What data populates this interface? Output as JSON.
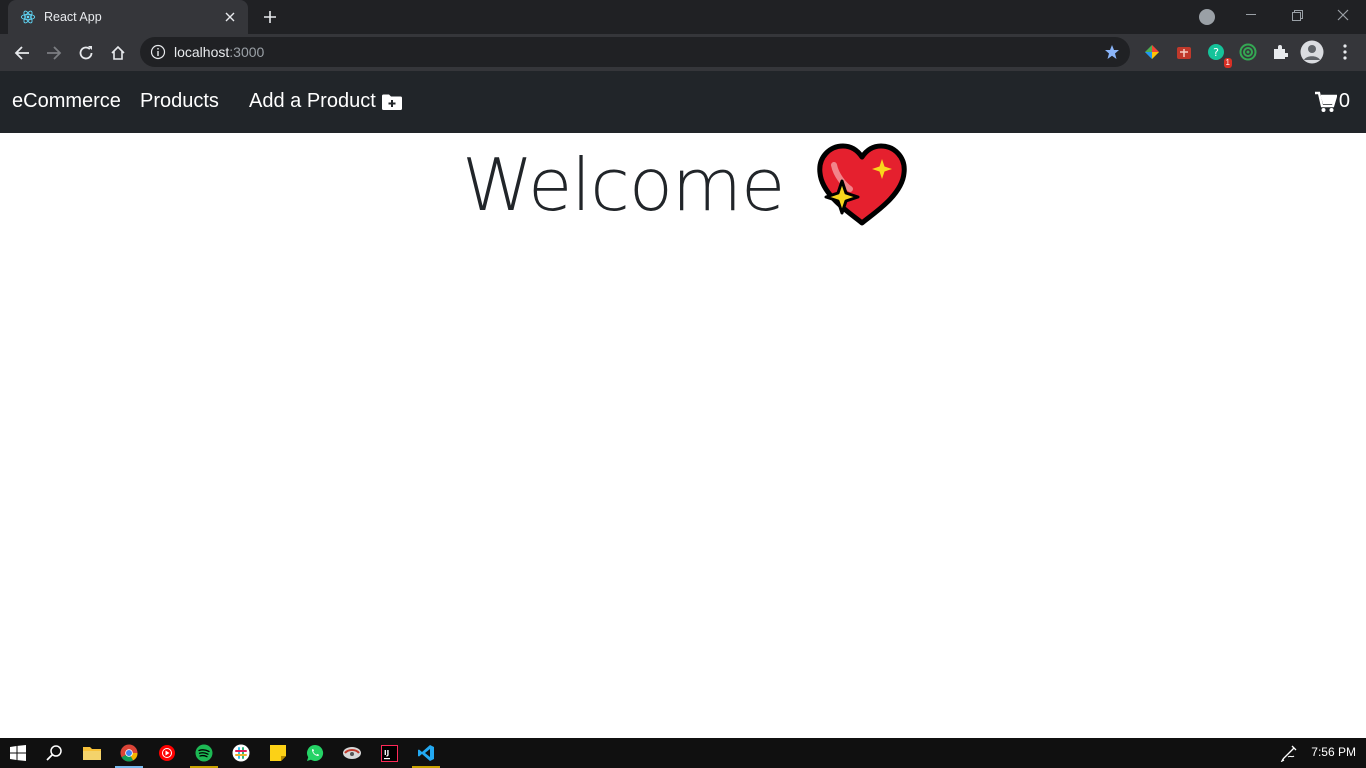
{
  "browser": {
    "tab_title": "React App",
    "url_host": "localhost",
    "url_port": ":3000",
    "extension_badge": "1"
  },
  "navbar": {
    "brand": "eCommerce",
    "links": [
      "Products",
      "Add a Product"
    ],
    "cart_count": "0"
  },
  "main": {
    "heading": "Welcome"
  },
  "taskbar": {
    "apps": [
      "start-icon",
      "search-icon",
      "file-explorer-icon",
      "chrome-icon",
      "youtube-music-icon",
      "spotify-icon",
      "slack-icon",
      "sticky-notes-icon",
      "whatsapp-icon",
      "app-icon",
      "intellij-icon",
      "vscode-icon"
    ],
    "time": "7:56 PM"
  },
  "colors": {
    "navbar_bg": "#212529",
    "chrome_dark": "#202124",
    "chrome_toolbar": "#35363a",
    "heart": "#e5202e"
  }
}
